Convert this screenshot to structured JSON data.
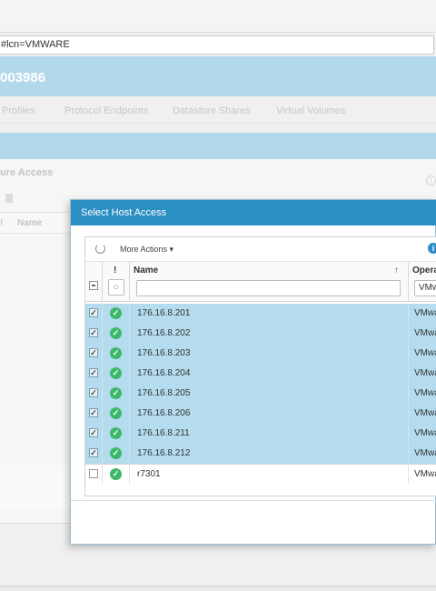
{
  "browser": {
    "url_fragment": "#lcn=VMWARE"
  },
  "background": {
    "title": "003986",
    "tabs": [
      "Profiles",
      "Protocol Endpoints",
      "Datastore Shares",
      "Virtual Volumes"
    ],
    "section_title": "ure Access",
    "col_excl": "!",
    "col_name": "Name"
  },
  "dialog": {
    "title": "Select Host Access",
    "toolbar": {
      "more_actions_label": "More Actions",
      "more_actions_caret": "▾",
      "info_glyph": "i",
      "refresh_icon": "refresh-icon"
    },
    "columns": {
      "excl": "!",
      "name": "Name",
      "sort_glyph": "↑",
      "operating": "Operat",
      "operating_filter_value": "VMw",
      "filter_glyph": "🔍"
    },
    "rows": [
      {
        "name": "176.16.8.201",
        "os": "VMwa",
        "checked": true,
        "check_glyph": "✓"
      },
      {
        "name": "176.16.8.202",
        "os": "VMwa",
        "checked": true,
        "check_glyph": "✓"
      },
      {
        "name": "176.16.8.203",
        "os": "VMwa",
        "checked": true,
        "check_glyph": "✓"
      },
      {
        "name": "176.16.8.204",
        "os": "VMwa",
        "checked": true,
        "check_glyph": "✓"
      },
      {
        "name": "176.16.8.205",
        "os": "VMwa",
        "checked": true,
        "check_glyph": "✓"
      },
      {
        "name": "176.16.8.206",
        "os": "VMwa",
        "checked": true,
        "check_glyph": "✓"
      },
      {
        "name": "176.16.8.211",
        "os": "VMwa",
        "checked": true,
        "check_glyph": "✓"
      },
      {
        "name": "176.16.8.212",
        "os": "VMwa",
        "checked": true,
        "check_glyph": "✓"
      },
      {
        "name": "r7301",
        "os": "VMwa",
        "checked": false,
        "check_glyph": ""
      }
    ],
    "status_glyph": "✓"
  },
  "colors": {
    "header_blue": "#2b8fc3",
    "band_blue": "#b2d9eb",
    "selected_row": "#b4dcee",
    "status_ok": "#3cb86a"
  }
}
